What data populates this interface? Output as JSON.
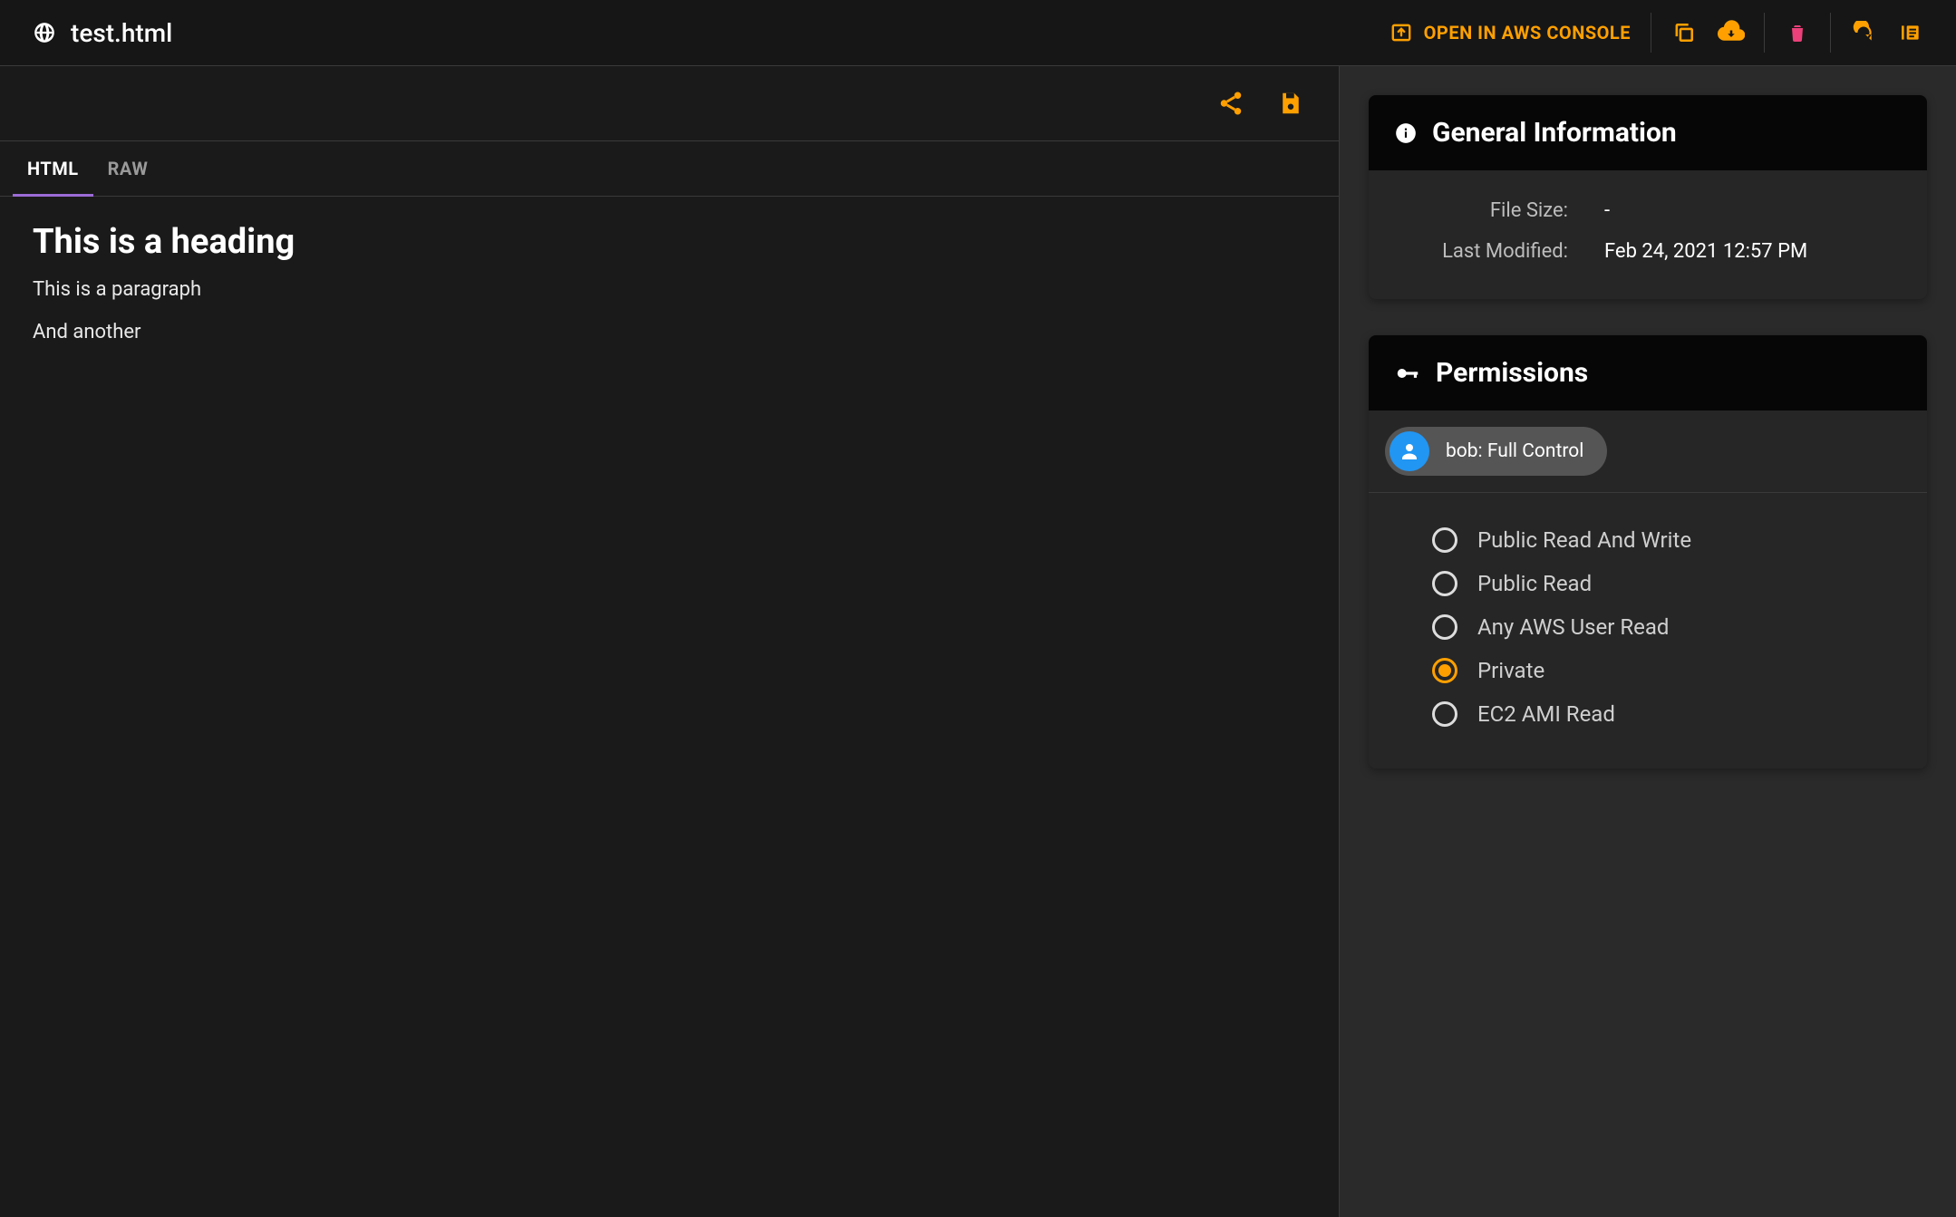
{
  "header": {
    "filename": "test.html",
    "aws_label": "OPEN IN AWS CONSOLE"
  },
  "tabs": {
    "items": [
      "HTML",
      "RAW"
    ],
    "active": 0
  },
  "preview": {
    "heading": "This is a heading",
    "p1": "This is a paragraph",
    "p2": "And another"
  },
  "general": {
    "title": "General Information",
    "size_label": "File Size:",
    "size_value": "-",
    "modified_label": "Last Modified:",
    "modified_value": "Feb 24, 2021 12:57 PM"
  },
  "permissions": {
    "title": "Permissions",
    "chip": "bob: Full Control",
    "options": [
      "Public Read And Write",
      "Public Read",
      "Any AWS User Read",
      "Private",
      "EC2 AMI Read"
    ],
    "selected": 3
  },
  "colors": {
    "amber": "#ffa000",
    "pink": "#ec407a",
    "blue": "#2196f3"
  }
}
